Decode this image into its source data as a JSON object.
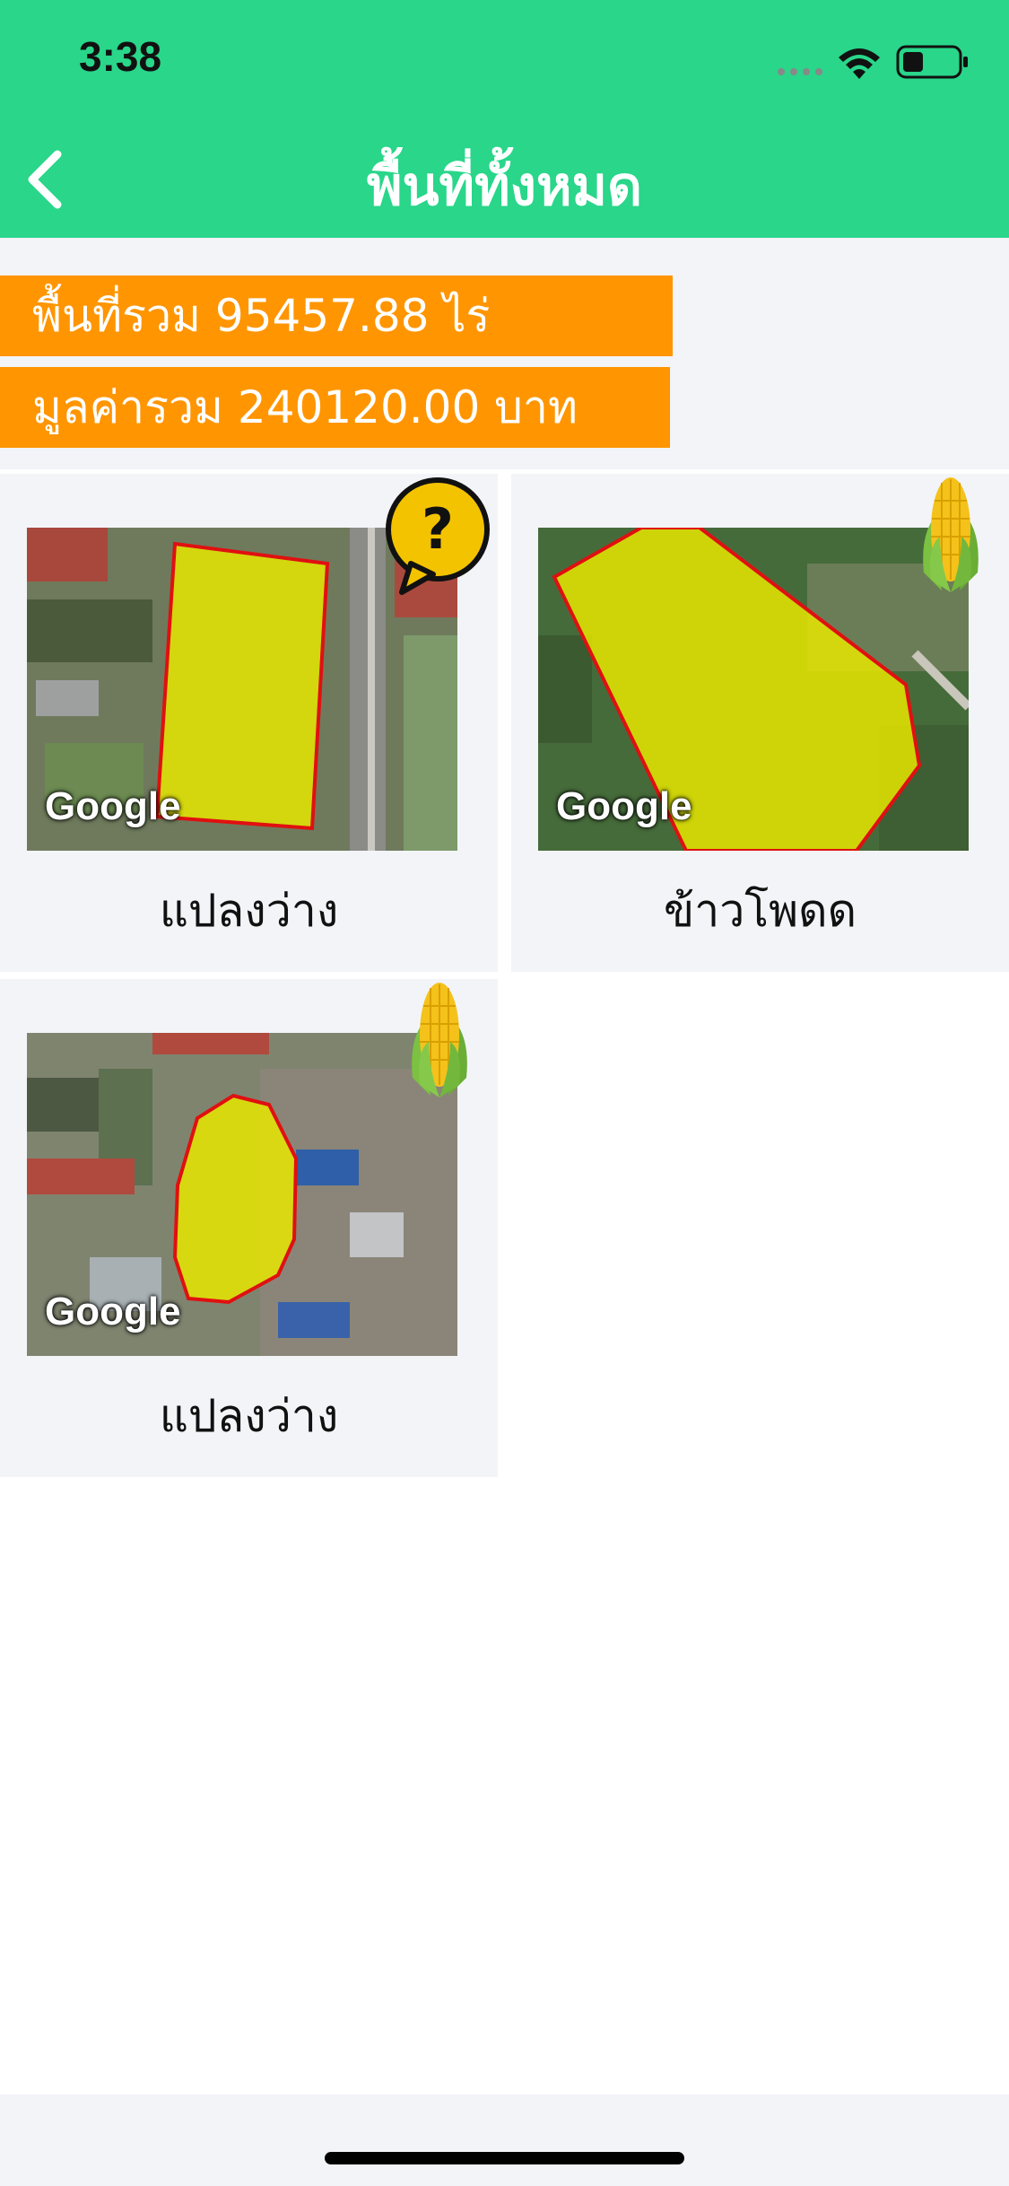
{
  "status": {
    "time": "3:38"
  },
  "header": {
    "title": "พื้นที่ทั้งหมด"
  },
  "summary": {
    "total_area": "พื้นที่รวม 95457.88 ไร่",
    "total_value": "มูลค่ารวม 240120.00 บาท"
  },
  "plots": [
    {
      "label": "แปลงว่าง",
      "badge": "question-icon"
    },
    {
      "label": "ข้าวโพดด",
      "badge": "corn-icon"
    },
    {
      "label": "แปลงว่าง",
      "badge": "corn-icon"
    }
  ],
  "map_attribution": "Google",
  "colors": {
    "header": "#29d68a",
    "summary_badge": "#ff9500",
    "plot_fill": "#e6e600",
    "plot_outline": "#e01010"
  }
}
